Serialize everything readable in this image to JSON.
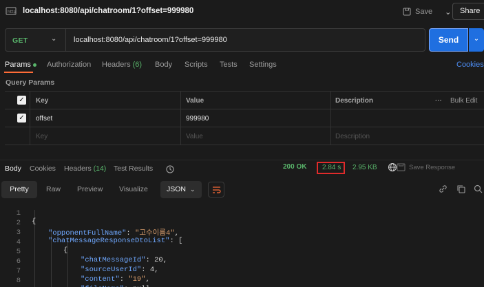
{
  "topbar": {
    "title": "localhost:8080/api/chatroom/1?offset=999980",
    "save_label": "Save",
    "share_label": "Share"
  },
  "request": {
    "method": "GET",
    "url": "localhost:8080/api/chatroom/1?offset=999980",
    "send_label": "Send"
  },
  "request_tabs": {
    "params": "Params",
    "authorization": "Authorization",
    "headers": "Headers",
    "headers_count": "(6)",
    "body": "Body",
    "scripts": "Scripts",
    "tests": "Tests",
    "settings": "Settings",
    "cookies": "Cookies"
  },
  "query_params": {
    "section_label": "Query Params",
    "columns": {
      "key": "Key",
      "value": "Value",
      "description": "Description",
      "bulk_edit": "Bulk Edit"
    },
    "rows": [
      {
        "key": "offset",
        "value": "999980",
        "description": "",
        "checked": true
      }
    ],
    "placeholder": {
      "key": "Key",
      "value": "Value",
      "description": "Description"
    }
  },
  "response_tabs": {
    "body": "Body",
    "cookies": "Cookies",
    "headers": "Headers",
    "headers_count": "(14)",
    "test_results": "Test Results"
  },
  "response_meta": {
    "status": "200 OK",
    "time": "2.84 s",
    "size": "2.95 KB",
    "save_response": "Save Response"
  },
  "view_options": {
    "pretty": "Pretty",
    "raw": "Raw",
    "preview": "Preview",
    "visualize": "Visualize",
    "format": "JSON"
  },
  "code_lines": [
    {
      "num": "1",
      "text": "{"
    },
    {
      "num": "2",
      "key": "\"opponentFullName\"",
      "value": "\"고수이름4\""
    },
    {
      "num": "3",
      "key": "\"chatMessageResponseDtoList\"",
      "value": "["
    },
    {
      "num": "4",
      "text": "{"
    },
    {
      "num": "5",
      "key": "\"chatMessageId\"",
      "value": "20"
    },
    {
      "num": "6",
      "key": "\"sourceUserId\"",
      "value": "4"
    },
    {
      "num": "7",
      "key": "\"content\"",
      "value": "\"19\""
    },
    {
      "num": "8",
      "key": "\"fileName\"",
      "value": "null"
    }
  ],
  "colors": {
    "accent_send": "#1f6fe0",
    "method_get": "#59b56b",
    "status_ok": "#59b56b",
    "highlight_box": "#e02b2b",
    "json_key": "#6fa8ff",
    "json_string": "#d79c6b"
  }
}
